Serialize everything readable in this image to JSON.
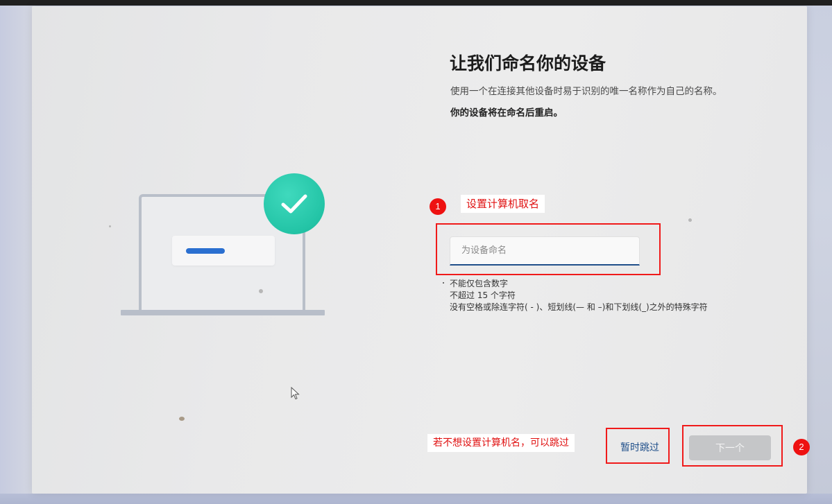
{
  "page": {
    "title": "让我们命名你的设备",
    "subtitle": "使用一个在连接其他设备时易于识别的唯一名称作为自己的名称。",
    "restart_note": "你的设备将在命名后重启。"
  },
  "name_input": {
    "placeholder": "为设备命名",
    "value": ""
  },
  "rules": [
    "不能仅包含数字",
    "不超过 15 个字符",
    "没有空格或除连字符( - )、短划线(— 和 –)和下划线(_)之外的特殊字符"
  ],
  "buttons": {
    "skip_label": "暂时跳过",
    "next_label": "下一个"
  },
  "annotations": {
    "step1_number": "1",
    "step1_text": "设置计算机取名",
    "step2_number": "2",
    "skip_hint": "若不想设置计算机名，可以跳过",
    "color": "#f01a1a"
  },
  "colors": {
    "accent": "#1f4f8a",
    "check_circle": "#23c4a6",
    "illustration_bar": "#2a6fd0"
  }
}
